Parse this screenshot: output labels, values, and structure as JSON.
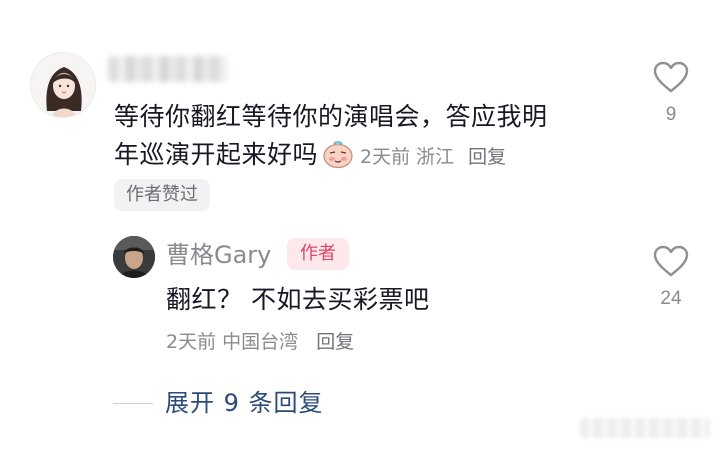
{
  "main_comment": {
    "text_line1": "等待你翻红等待你的演唱会，答应我明",
    "text_line2": "年巡演开起来好吗",
    "time": "2天前",
    "location": "浙江",
    "reply_label": "回复",
    "author_liked_badge": "作者赞过",
    "like_count": "9"
  },
  "reply": {
    "username": "曹格Gary",
    "author_badge": "作者",
    "text": "翻红？ 不如去买彩票吧",
    "time": "2天前",
    "location": "中国台湾",
    "reply_label": "回复",
    "like_count": "24"
  },
  "expand": {
    "label": "展开 9 条回复"
  },
  "colors": {
    "text_primary": "#161823",
    "text_secondary": "#8a8b91",
    "author_badge_bg": "#fde8ec",
    "author_badge_text": "#e04665",
    "expand_link": "#2b4a7a"
  },
  "icons": {
    "like": "heart-outline-icon",
    "sticker": "blushing-face-sticker"
  }
}
